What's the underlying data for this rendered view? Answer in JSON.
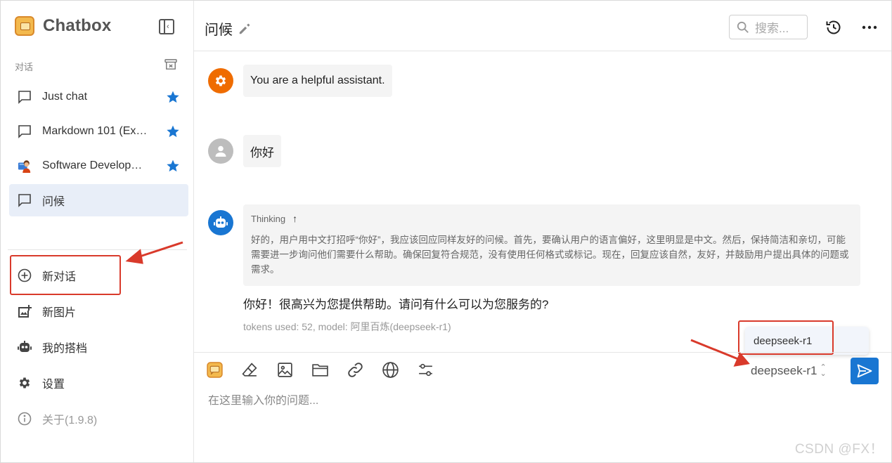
{
  "app": {
    "name": "Chatbox"
  },
  "sidebar": {
    "section_label": "对话",
    "conversations": [
      {
        "label": "Just chat",
        "starred": true,
        "icon": "chat-bubble-icon"
      },
      {
        "label": "Markdown 101 (Ex…",
        "starred": true,
        "icon": "chat-bubble-icon"
      },
      {
        "label": "Software Develop…",
        "starred": true,
        "icon": "developer-avatar-icon"
      },
      {
        "label": "问候",
        "starred": false,
        "icon": "chat-bubble-icon",
        "active": true
      }
    ],
    "menu": [
      {
        "label": "新对话",
        "icon": "plus-circle-icon"
      },
      {
        "label": "新图片",
        "icon": "add-image-icon"
      },
      {
        "label": "我的搭档",
        "icon": "robot-icon"
      },
      {
        "label": "设置",
        "icon": "gear-icon"
      },
      {
        "label": "关于(1.9.8)",
        "icon": "info-icon"
      }
    ]
  },
  "header": {
    "title": "问候",
    "search_placeholder": "搜索..."
  },
  "messages": {
    "system": "You are a helpful assistant.",
    "user": "你好",
    "thinking_label": "Thinking",
    "thinking_text": "好的，用户用中文打招呼“你好”，我应该回应同样友好的问候。首先，要确认用户的语言偏好，这里明显是中文。然后，保持简洁和亲切，可能需要进一步询问他们需要什么帮助。确保回复符合规范，没有使用任何格式或标记。现在，回复应该自然，友好，并鼓励用户提出具体的问题或需求。",
    "reply": "你好！很高兴为您提供帮助。请问有什么可以为您服务的?",
    "meta": "tokens used: 52, model: 阿里百炼(deepseek-r1)"
  },
  "model_dropdown": {
    "option": "deepseek-r1"
  },
  "input": {
    "selected_model": "deepseek-r1",
    "placeholder": "在这里输入你的问题..."
  },
  "watermark": "CSDN @FX！",
  "colors": {
    "accent": "#1976d2",
    "annotation": "#d93a2b",
    "system_avatar": "#ef6c00",
    "user_avatar": "#bdbdbd",
    "assistant_avatar": "#1976d2"
  }
}
